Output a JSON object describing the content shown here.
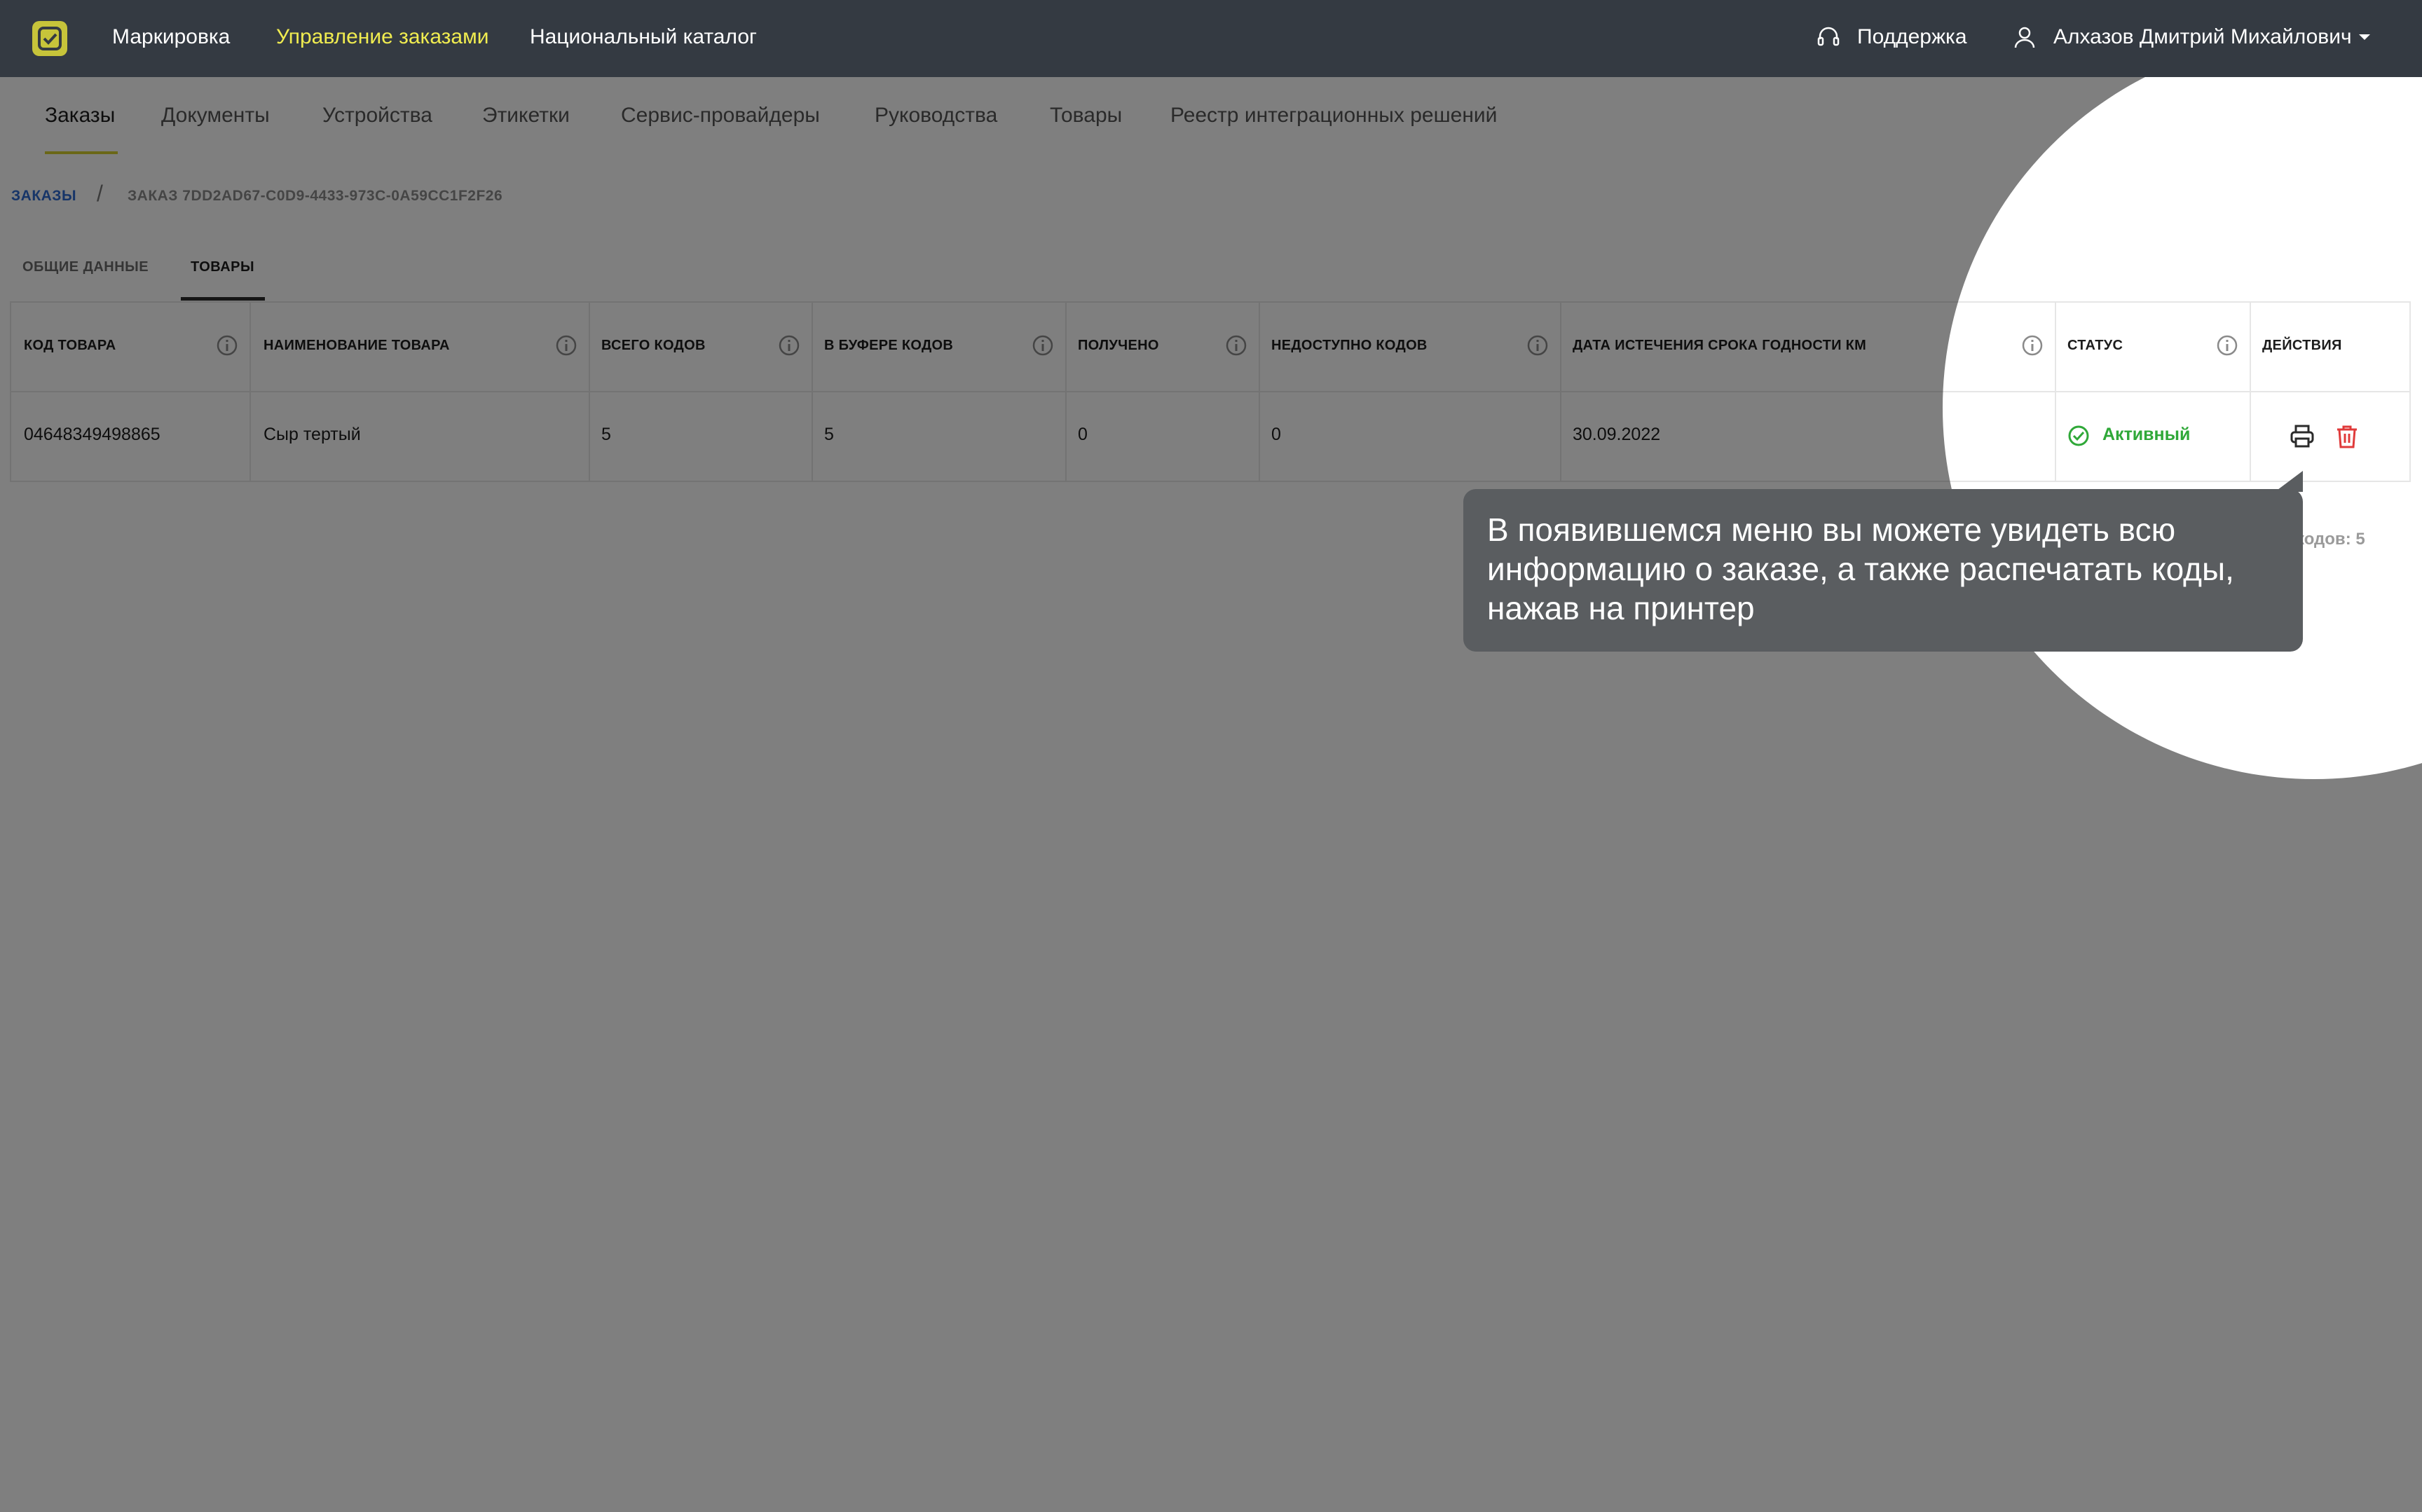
{
  "topbar": {
    "nav": [
      "Маркировка",
      "Управление заказами",
      "Национальный каталог"
    ],
    "active_index": 1,
    "support_label": "Поддержка",
    "user_name": "Алхазов Дмитрий Михайлович"
  },
  "subnav": {
    "items": [
      "Заказы",
      "Документы",
      "Устройства",
      "Этикетки",
      "Сервис-провайдеры",
      "Руководства",
      "Товары",
      "Реестр интеграционных решений"
    ],
    "active_index": 0
  },
  "breadcrumb": {
    "root": "ЗАКАЗЫ",
    "separator": "/",
    "current": "ЗАКАЗ 7DD2AD67-C0D9-4433-973C-0A59CC1F2F26"
  },
  "tabs": {
    "items": [
      "ОБЩИЕ ДАННЫЕ",
      "ТОВАРЫ"
    ],
    "active_index": 1
  },
  "table": {
    "columns": [
      "КОД ТОВАРА",
      "НАИМЕНОВАНИЕ ТОВАРА",
      "ВСЕГО КОДОВ",
      "В БУФЕРЕ КОДОВ",
      "ПОЛУЧЕНО",
      "НЕДОСТУПНО КОДОВ",
      "ДАТА ИСТЕЧЕНИЯ СРОКА ГОДНОСТИ КМ",
      "СТАТУС",
      "ДЕЙСТВИЯ"
    ],
    "rows": [
      {
        "code": "04648349498865",
        "name": "Сыр тертый",
        "total": "5",
        "buffer": "5",
        "received": "0",
        "unavailable": "0",
        "expiry": "30.09.2022",
        "status": "Активный"
      }
    ],
    "pager_text": "кодов: 5"
  },
  "tooltip": {
    "line1": "В появившемся меню вы можете увидеть всю",
    "line2": "информацию о заказе, а также распечатать коды,",
    "line3": "нажав на принтер"
  },
  "icons": {
    "logo": "app-logo-icon",
    "support": "headset-icon",
    "user": "user-icon",
    "dropdown": "chevron-down-icon",
    "info": "info-icon",
    "status": "check-circle-icon",
    "print": "printer-icon",
    "delete": "trash-icon"
  },
  "colors": {
    "topbar_bg": "#343a42",
    "accent": "#d4ce2e",
    "link": "#2f6bd0",
    "status_active": "#2fa838",
    "delete": "#e03a3a",
    "tooltip_bg": "#5a5d60"
  }
}
